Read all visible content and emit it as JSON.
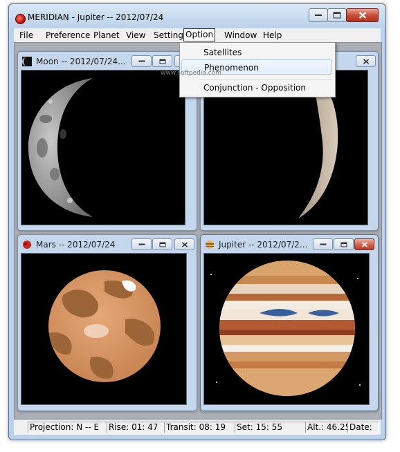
{
  "window": {
    "title": "MERIDIAN -  Jupiter -- 2012/07/24"
  },
  "menu": {
    "items": [
      "File",
      "Preference",
      "Planet",
      "View",
      "Setting",
      "Option",
      "Window",
      "Help"
    ],
    "open_menu": "Option",
    "dropdown": [
      "Satellites",
      "Phenomenon",
      "Conjunction - Opposition"
    ],
    "highlighted": "Phenomenon"
  },
  "children": [
    {
      "title": "Moon -- 2012/07/24...",
      "icon": "moon-icon"
    },
    {
      "title": "",
      "icon": "venus-icon"
    },
    {
      "title": "Mars -- 2012/07/24",
      "icon": "mars-icon"
    },
    {
      "title": "Jupiter -- 2012/07/2...",
      "icon": "jupiter-icon"
    }
  ],
  "statusbar": {
    "projection": "Projection: N -- E",
    "rise": "Rise: 01: 47",
    "transit": "Transit: 08: 19",
    "set": "Set: 15: 55",
    "alt": "Alt.: 46.25",
    "date": "Date:"
  },
  "watermark": "www.softpedia.com",
  "colors": {
    "mdi_background": "#abafb5",
    "child_frame": "#c4d7ec",
    "close_button": "#c74832",
    "menu_highlight": "#e3edf9"
  }
}
